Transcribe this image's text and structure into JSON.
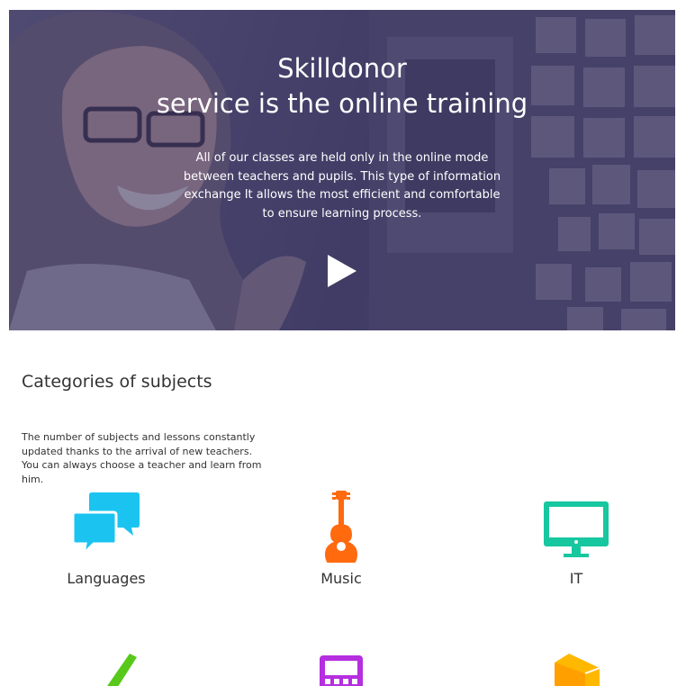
{
  "hero": {
    "title_line1": "Skilldonor",
    "title_line2": "service is the online training",
    "description": "All of our classes are held only in the online mode between teachers and pupils. This type of information exchange It allows the most efficient and comfortable to ensure learning process.",
    "play_icon": "play-icon"
  },
  "categories": {
    "title": "Categories of subjects",
    "description": "The number of subjects and lessons constantly updated thanks to the arrival of new teachers. You can always choose a teacher and learn from him.",
    "items": [
      {
        "label": "Languages",
        "icon": "chat-bubbles-icon",
        "color": "#1bc4f0"
      },
      {
        "label": "Music",
        "icon": "ukulele-icon",
        "color": "#ff6a0f"
      },
      {
        "label": "IT",
        "icon": "monitor-icon",
        "color": "#17c7a0"
      },
      {
        "label": "",
        "icon": "pen-icon",
        "color": "#58c91a"
      },
      {
        "label": "",
        "icon": "calculator-icon",
        "color": "#b52ee0"
      },
      {
        "label": "",
        "icon": "book-icon",
        "color": "#ffb800"
      }
    ]
  }
}
